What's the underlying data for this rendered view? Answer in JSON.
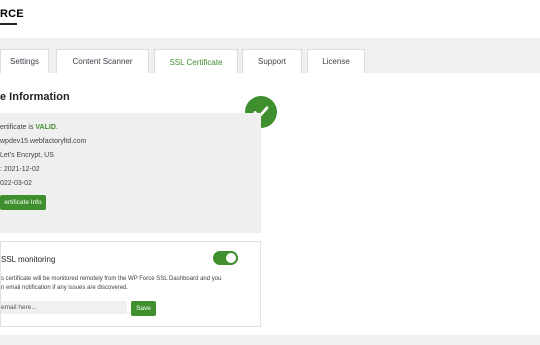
{
  "brand": {
    "name": "RCE"
  },
  "tabs": [
    {
      "label": "Settings",
      "active": false
    },
    {
      "label": "Content Scanner",
      "active": false
    },
    {
      "label": "SSL Certificate",
      "active": true
    },
    {
      "label": "Support",
      "active": false
    },
    {
      "label": "License",
      "active": false
    }
  ],
  "certificate": {
    "section_title": "e Information",
    "status_prefix": "ertificate is ",
    "status_value": "VALID",
    "status_suffix": ".",
    "domain": "wpdev15.webfactoryltd.com",
    "issuer": "Let's Encrypt, US",
    "valid_from": ": 2021-12-02",
    "valid_to": "022-03-02",
    "refresh_button": "ertificate Info",
    "status_icon": "check-icon"
  },
  "monitoring": {
    "title": "SSL monitoring",
    "enabled": true,
    "description_line1": "s certificate will be monitored remotely from the WP Force SSL Dashboard and you",
    "description_line2": "n email notification if any issues are discovered.",
    "email_placeholder": "email here...",
    "save_button": "Save"
  },
  "colors": {
    "accent": "#3f8f2e",
    "info_bg": "#f0efef",
    "page_bg": "#f0f0f1"
  }
}
